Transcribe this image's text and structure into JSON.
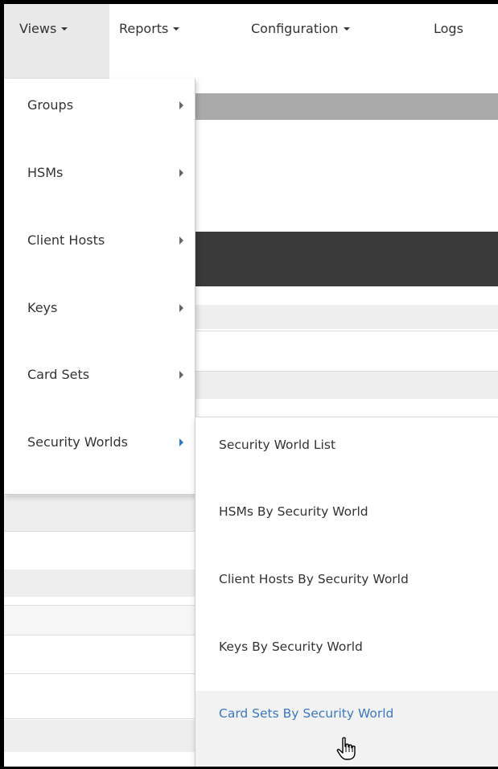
{
  "navbar": {
    "items": [
      {
        "label": "Views",
        "has_caret": true,
        "active": true
      },
      {
        "label": "Reports",
        "has_caret": true,
        "active": false
      },
      {
        "label": "Configuration",
        "has_caret": true,
        "active": false
      },
      {
        "label": "Logs",
        "has_caret": false,
        "active": false
      }
    ]
  },
  "views_menu": {
    "items": [
      {
        "label": "Groups",
        "submenu_icon": "chevron-right-icon"
      },
      {
        "label": "HSMs",
        "submenu_icon": "chevron-right-icon"
      },
      {
        "label": "Client Hosts",
        "submenu_icon": "chevron-right-icon"
      },
      {
        "label": "Keys",
        "submenu_icon": "chevron-right-icon"
      },
      {
        "label": "Card Sets",
        "submenu_icon": "chevron-right-icon"
      },
      {
        "label": "Security Worlds",
        "submenu_icon": "chevron-right-icon",
        "expanded": true
      }
    ]
  },
  "security_worlds_submenu": {
    "items": [
      {
        "label": "Security World List"
      },
      {
        "label": "HSMs By Security World"
      },
      {
        "label": "Client Hosts By Security World"
      },
      {
        "label": "Keys By Security World"
      },
      {
        "label": "Card Sets By Security World",
        "hovered": true
      }
    ]
  },
  "colors": {
    "hover_link": "#3c78c2",
    "active_arrow": "#2a7bd0",
    "active_nav_bg": "#e9e9e9",
    "dark_band": "#3a3a3a",
    "gray_band": "#aaaaaa"
  },
  "cursor": {
    "icon": "hand-pointer-icon"
  }
}
